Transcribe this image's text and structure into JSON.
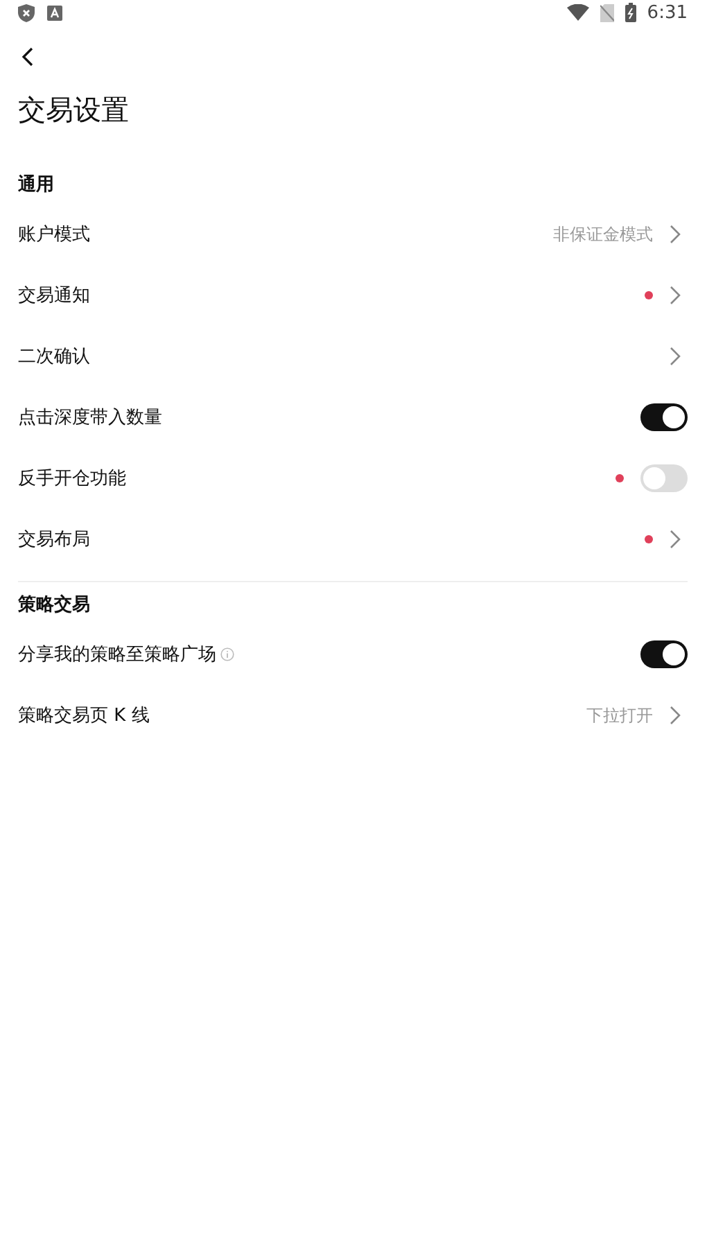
{
  "status_bar": {
    "time": "6:31"
  },
  "title": "交易设置",
  "sections": [
    {
      "heading": "通用",
      "rows": [
        {
          "kind": "link",
          "label": "账户模式",
          "value": "非保证金模式",
          "badge": false,
          "info": false
        },
        {
          "kind": "link",
          "label": "交易通知",
          "badge": true,
          "info": false
        },
        {
          "kind": "link",
          "label": "二次确认",
          "badge": false,
          "info": false
        },
        {
          "kind": "toggle",
          "label": "点击深度带入数量",
          "on": true,
          "badge": false,
          "info": false
        },
        {
          "kind": "toggle",
          "label": "反手开仓功能",
          "on": false,
          "badge": true,
          "info": false
        },
        {
          "kind": "link",
          "label": "交易布局",
          "badge": true,
          "info": false
        }
      ]
    },
    {
      "heading": "策略交易",
      "rows": [
        {
          "kind": "toggle",
          "label": "分享我的策略至策略广场",
          "on": true,
          "badge": false,
          "info": true
        },
        {
          "kind": "link",
          "label": "策略交易页 K 线",
          "value": "下拉打开",
          "badge": false,
          "info": false
        }
      ]
    }
  ]
}
